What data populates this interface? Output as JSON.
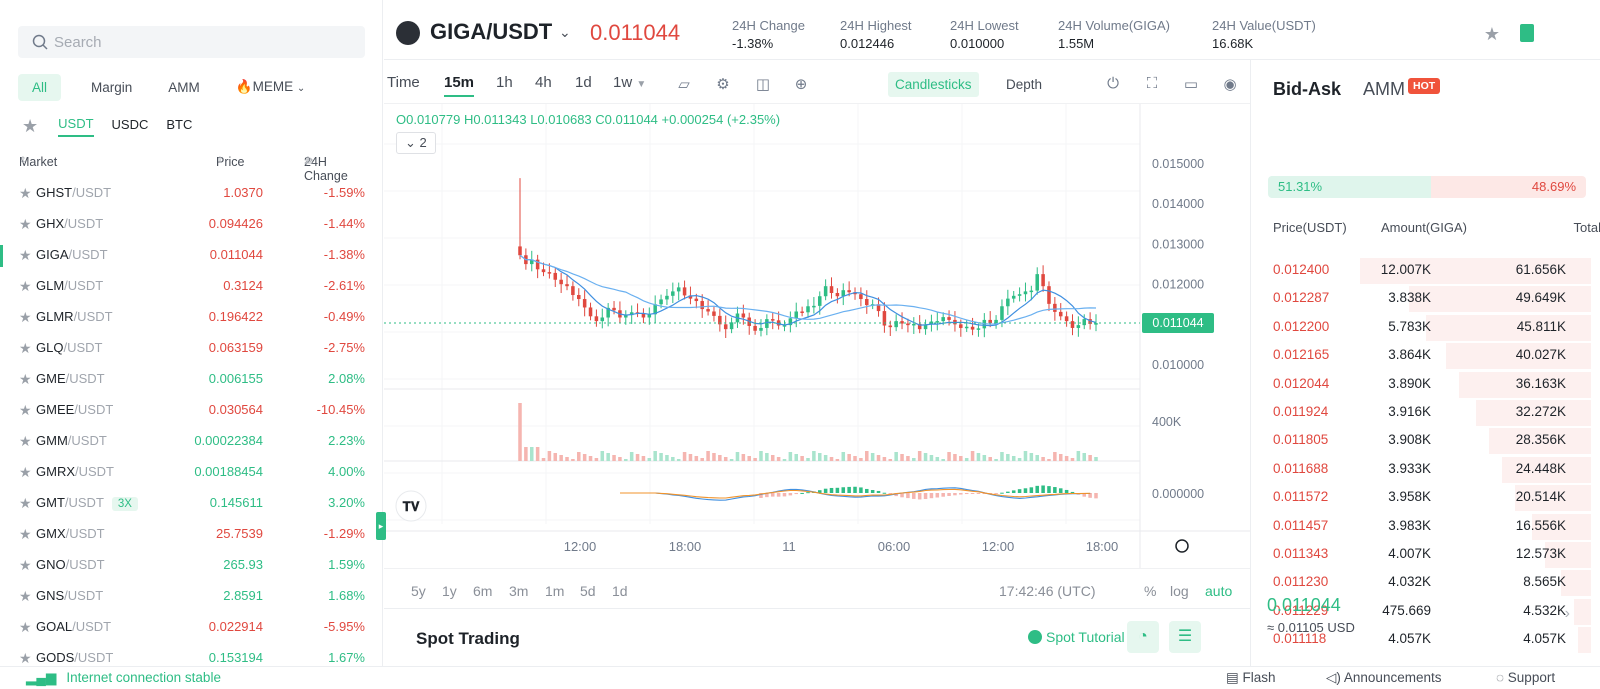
{
  "left": {
    "search_placeholder": "Search",
    "category_tabs": [
      "All",
      "Margin",
      "AMM",
      "🔥MEME"
    ],
    "quote_tabs": [
      "USDT",
      "USDC",
      "BTC"
    ],
    "headers": {
      "market": "Market",
      "price": "Price",
      "change": "24H Change"
    },
    "markets": [
      {
        "base": "GHST",
        "quote": "/USDT",
        "price": "1.0370",
        "change": "-1.59%",
        "dir": "down"
      },
      {
        "base": "GHX",
        "quote": "/USDT",
        "price": "0.094426",
        "change": "-1.44%",
        "dir": "down"
      },
      {
        "base": "GIGA",
        "quote": "/USDT",
        "price": "0.011044",
        "change": "-1.38%",
        "dir": "down",
        "selected": true
      },
      {
        "base": "GLM",
        "quote": "/USDT",
        "price": "0.3124",
        "change": "-2.61%",
        "dir": "down"
      },
      {
        "base": "GLMR",
        "quote": "/USDT",
        "price": "0.196422",
        "change": "-0.49%",
        "dir": "down"
      },
      {
        "base": "GLQ",
        "quote": "/USDT",
        "price": "0.063159",
        "change": "-2.75%",
        "dir": "down"
      },
      {
        "base": "GME",
        "quote": "/USDT",
        "price": "0.006155",
        "change": "2.08%",
        "dir": "up"
      },
      {
        "base": "GMEE",
        "quote": "/USDT",
        "price": "0.030564",
        "change": "-10.45%",
        "dir": "down"
      },
      {
        "base": "GMM",
        "quote": "/USDT",
        "price": "0.00022384",
        "change": "2.23%",
        "dir": "up"
      },
      {
        "base": "GMRX",
        "quote": "/USDT",
        "price": "0.00188454",
        "change": "4.00%",
        "dir": "up"
      },
      {
        "base": "GMT",
        "quote": "/USDT",
        "price": "0.145611",
        "change": "3.20%",
        "dir": "up",
        "leverage": "3X"
      },
      {
        "base": "GMX",
        "quote": "/USDT",
        "price": "25.7539",
        "change": "-1.29%",
        "dir": "down"
      },
      {
        "base": "GNO",
        "quote": "/USDT",
        "price": "265.93",
        "change": "1.59%",
        "dir": "up"
      },
      {
        "base": "GNS",
        "quote": "/USDT",
        "price": "2.8591",
        "change": "1.68%",
        "dir": "up"
      },
      {
        "base": "GOAL",
        "quote": "/USDT",
        "price": "0.022914",
        "change": "-5.95%",
        "dir": "down"
      },
      {
        "base": "GODS",
        "quote": "/USDT",
        "price": "0.153194",
        "change": "1.67%",
        "dir": "up"
      }
    ]
  },
  "header": {
    "pair": "GIGA/USDT",
    "last_price": "0.011044",
    "stats": [
      {
        "label": "24H Change",
        "value": "-1.38%",
        "color": "#e0483f"
      },
      {
        "label": "24H Highest",
        "value": "0.012446"
      },
      {
        "label": "24H Lowest",
        "value": "0.010000"
      },
      {
        "label": "24H Volume(GIGA)",
        "value": "1.55M"
      },
      {
        "label": "24H Value(USDT)",
        "value": "16.68K"
      }
    ]
  },
  "chart_toolbar": {
    "timeframes": [
      "Time",
      "15m",
      "1h",
      "4h",
      "1d",
      "1w"
    ],
    "active_timeframe": "15m",
    "icons": [
      "indicator-chart-icon",
      "settings-icon",
      "compare-icon",
      "add-icon"
    ],
    "candlesticks_label": "Candlesticks",
    "depth_label": "Depth",
    "right_icons": [
      "power-icon",
      "fullscreen-icon",
      "layout-icon",
      "camera-icon"
    ]
  },
  "chart_legend": {
    "ohlc": "O0.010779  H0.011343  L0.010683  C0.011044  +0.000254 (+2.35%)",
    "indicator_toggle": "2"
  },
  "chart_data": {
    "type": "candlestick",
    "price_ticks": [
      "0.015000",
      "0.014000",
      "0.013000",
      "0.012000",
      "0.010000"
    ],
    "price_tick_values": [
      0.015,
      0.014,
      0.013,
      0.012,
      0.01
    ],
    "ylim": [
      0.0094,
      0.0155
    ],
    "last_price_label": "0.011044",
    "last_price": 0.011044,
    "volume_tick": "400K",
    "macd_tick": "0.000000",
    "time_ticks": [
      "12:00",
      "18:00",
      "11",
      "06:00",
      "12:00",
      "18:00"
    ],
    "closes": [
      0.01273,
      0.01251,
      0.01262,
      0.01238,
      0.01231,
      0.01229,
      0.01212,
      0.01201,
      0.01196,
      0.01174,
      0.01164,
      0.01143,
      0.01121,
      0.01109,
      0.01118,
      0.01142,
      0.01136,
      0.01118,
      0.01124,
      0.01131,
      0.01129,
      0.01118,
      0.01126,
      0.01151,
      0.01163,
      0.01172,
      0.01183,
      0.01193,
      0.01173,
      0.01165,
      0.01159,
      0.01139,
      0.01133,
      0.01122,
      0.01101,
      0.01089,
      0.01106,
      0.01128,
      0.01118,
      0.01097,
      0.01085,
      0.01092,
      0.01114,
      0.01111,
      0.01098,
      0.01099,
      0.01116,
      0.01133,
      0.01131,
      0.01146,
      0.01147,
      0.01171,
      0.01196,
      0.01179,
      0.01171,
      0.01186,
      0.01181,
      0.01176,
      0.01164,
      0.01149,
      0.01151,
      0.01134,
      0.01098,
      0.01094,
      0.01109,
      0.01103,
      0.01099,
      0.01102,
      0.01089,
      0.01101,
      0.01108,
      0.01109,
      0.01119,
      0.01112,
      0.01101,
      0.01092,
      0.01095,
      0.01088,
      0.01091,
      0.01112,
      0.01104,
      0.01112,
      0.01146,
      0.01165,
      0.01172,
      0.01176,
      0.01183,
      0.01185,
      0.01226,
      0.01196,
      0.01152,
      0.01132,
      0.01121,
      0.01109,
      0.01092,
      0.01099,
      0.01114,
      0.01102,
      0.01104
    ]
  },
  "range_bar": {
    "ranges": [
      "5y",
      "1y",
      "6m",
      "3m",
      "1m",
      "5d",
      "1d"
    ],
    "clock": "17:42:46 (UTC)",
    "pct": "%",
    "log": "log",
    "auto": "auto"
  },
  "spot": {
    "title": "Spot Trading",
    "tutorial": "Spot Tutorial"
  },
  "book": {
    "tab_bidask": "Bid-Ask",
    "tab_amm": "AMM",
    "hot": "HOT",
    "buy_ratio": "51.31%",
    "sell_ratio": "48.69%",
    "buy_ratio_value": 51.31,
    "headers": {
      "price": "Price(USDT)",
      "amount": "Amount(GIGA)",
      "total": "Total"
    },
    "asks": [
      {
        "price": "0.012400",
        "amount": "12.007K",
        "total": "61.656K",
        "depth": 0.7
      },
      {
        "price": "0.012287",
        "amount": "3.838K",
        "total": "49.649K",
        "depth": 0.55
      },
      {
        "price": "0.012200",
        "amount": "5.783K",
        "total": "45.811K",
        "depth": 0.5
      },
      {
        "price": "0.012165",
        "amount": "3.864K",
        "total": "40.027K",
        "depth": 0.44
      },
      {
        "price": "0.012044",
        "amount": "3.890K",
        "total": "36.163K",
        "depth": 0.4
      },
      {
        "price": "0.011924",
        "amount": "3.916K",
        "total": "32.272K",
        "depth": 0.35
      },
      {
        "price": "0.011805",
        "amount": "3.908K",
        "total": "28.356K",
        "depth": 0.31
      },
      {
        "price": "0.011688",
        "amount": "3.933K",
        "total": "24.448K",
        "depth": 0.27
      },
      {
        "price": "0.011572",
        "amount": "3.958K",
        "total": "20.514K",
        "depth": 0.23
      },
      {
        "price": "0.011457",
        "amount": "3.983K",
        "total": "16.556K",
        "depth": 0.18
      },
      {
        "price": "0.011343",
        "amount": "4.007K",
        "total": "12.573K",
        "depth": 0.14
      },
      {
        "price": "0.011230",
        "amount": "4.032K",
        "total": "8.565K",
        "depth": 0.09
      },
      {
        "price": "0.011229",
        "amount": "475.669",
        "total": "4.532K",
        "depth": 0.05
      },
      {
        "price": "0.011118",
        "amount": "4.057K",
        "total": "4.057K",
        "depth": 0.04
      }
    ],
    "last_price": "0.011044",
    "usd_price": "≈ 0.01105 USD"
  },
  "status": {
    "connection": "Internet connection stable",
    "links": [
      "Flash",
      "Announcements",
      "Support"
    ]
  },
  "colors": {
    "up": "#2ebd85",
    "down": "#e0483f",
    "accent": "#2ebd85",
    "hot": "#f0533b"
  }
}
